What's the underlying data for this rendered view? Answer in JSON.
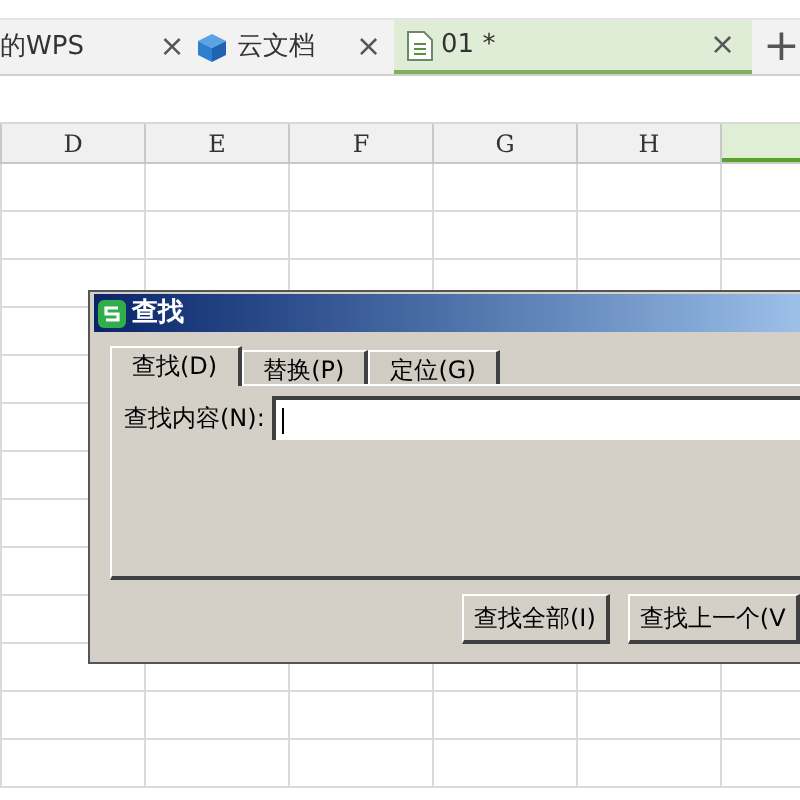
{
  "tabs": [
    {
      "label": "的WPS",
      "kind": "plain",
      "selected": false,
      "close": "×"
    },
    {
      "label": "云文档",
      "kind": "cloud",
      "selected": false,
      "close": "×"
    },
    {
      "label": "01 *",
      "kind": "doc",
      "selected": true,
      "close": "×"
    }
  ],
  "new_tab": "+",
  "columns": [
    {
      "label": "D",
      "selected": false
    },
    {
      "label": "E",
      "selected": false
    },
    {
      "label": "F",
      "selected": false
    },
    {
      "label": "G",
      "selected": false
    },
    {
      "label": "H",
      "selected": false
    },
    {
      "selected": true
    }
  ],
  "dialog": {
    "title": "查找",
    "tabs": [
      {
        "label": "查找(D)",
        "selected": true
      },
      {
        "label": "替换(P)",
        "selected": false
      },
      {
        "label": "定位(G)",
        "selected": false
      }
    ],
    "find_label": "查找内容(N):",
    "buttons": [
      "查找全部(I)",
      "查找上一个(V"
    ]
  }
}
